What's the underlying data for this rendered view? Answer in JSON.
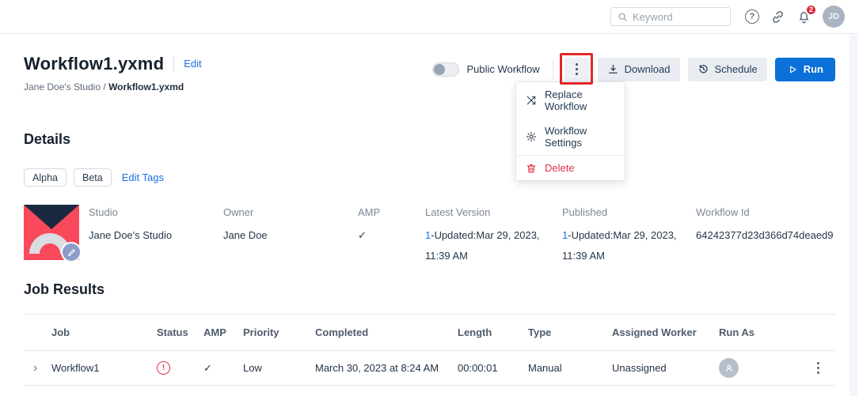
{
  "colors": {
    "accent_blue": "#0b70d8",
    "link_blue": "#1a6fe8",
    "danger_red": "#e0314b",
    "annotation_red": "#e12727",
    "logo_red": "#f9495a",
    "logo_navy": "#1b2940",
    "badge_red": "#e02b3d"
  },
  "icons": {
    "help_glyph": "?",
    "chevron_right": "›",
    "error_glyph": "!",
    "check_glyph": "✓",
    "breadcrumb_separator": "/"
  },
  "topbar": {
    "search_placeholder": "Keyword",
    "notification_badge": "2",
    "avatar_initials": "JD"
  },
  "page": {
    "title": "Workflow1.yxmd",
    "edit_label": "Edit",
    "breadcrumb_studio": "Jane Doe's Studio",
    "breadcrumb_current": "Workflow1.yxmd",
    "public_workflow_label": "Public Workflow",
    "download_label": "Download",
    "schedule_label": "Schedule",
    "run_label": "Run"
  },
  "context_menu": {
    "replace_label": "Replace Workflow",
    "settings_label": "Workflow Settings",
    "delete_label": "Delete"
  },
  "details": {
    "heading": "Details",
    "tags": [
      "Alpha",
      "Beta"
    ],
    "edit_tags_label": "Edit Tags",
    "fields": {
      "studio": {
        "label": "Studio",
        "value": "Jane Doe's Studio"
      },
      "owner": {
        "label": "Owner",
        "value": "Jane Doe"
      },
      "amp": {
        "label": "AMP"
      },
      "latest_version": {
        "label": "Latest Version",
        "version_link": "1",
        "value": "-Updated:Mar 29, 2023, 11:39 AM"
      },
      "published": {
        "label": "Published",
        "version_link": "1",
        "value": "-Updated:Mar 29, 2023, 11:39 AM"
      },
      "workflow_id": {
        "label": "Workflow Id",
        "value": "64242377d23d366d74deaed9"
      }
    }
  },
  "job_results": {
    "heading": "Job Results",
    "columns": [
      "Job",
      "Status",
      "AMP",
      "Priority",
      "Completed",
      "Length",
      "Type",
      "Assigned Worker",
      "Run As"
    ],
    "row": {
      "job": "Workflow1",
      "priority": "Low",
      "completed": "March 30, 2023 at 8:24 AM",
      "length": "00:00:01",
      "type": "Manual",
      "assigned_worker": "Unassigned"
    }
  }
}
